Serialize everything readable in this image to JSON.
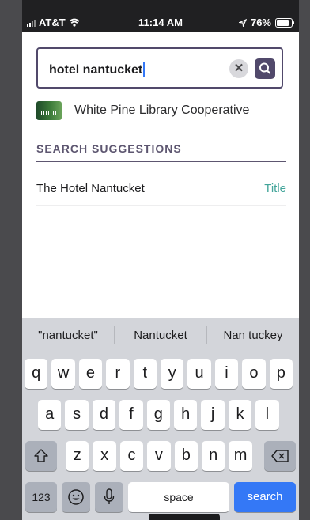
{
  "status_bar": {
    "carrier": "AT&T",
    "time": "11:14 AM",
    "battery": "76%",
    "battery_level": 0.76
  },
  "search": {
    "query": "hotel nantucket"
  },
  "library": {
    "name": "White Pine Library Cooperative"
  },
  "suggestions": {
    "title": "SEARCH SUGGESTIONS",
    "items": [
      {
        "text": "The Hotel Nantucket",
        "type": "Title"
      }
    ]
  },
  "keyboard": {
    "predictions": [
      "\"nantucket\"",
      "Nantucket",
      "Nan tuckey"
    ],
    "row1": [
      "q",
      "w",
      "e",
      "r",
      "t",
      "y",
      "u",
      "i",
      "o",
      "p"
    ],
    "row2": [
      "a",
      "s",
      "d",
      "f",
      "g",
      "h",
      "j",
      "k",
      "l"
    ],
    "row3": [
      "z",
      "x",
      "c",
      "v",
      "b",
      "n",
      "m"
    ],
    "numbers_label": "123",
    "space_label": "space",
    "search_label": "search"
  }
}
